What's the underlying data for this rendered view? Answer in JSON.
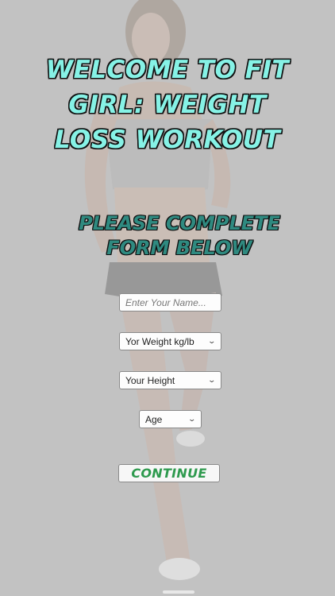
{
  "app": {
    "title": "WELCOME TO FIT GIRL: WEIGHT LOSS WORKOUT",
    "subtitle": "PLEASE COMPLETE FORM BELOW"
  },
  "form": {
    "name_placeholder": "Enter Your Name...",
    "name_value": "",
    "weight_selected": "Yor Weight kg/lb",
    "height_selected": "Your Height",
    "age_selected": "Age",
    "continue_label": "CONTINUE"
  },
  "icons": {
    "dropdown": "chevron-down-icon"
  },
  "colors": {
    "title": "#86f2e6",
    "subtitle": "#2f8a80",
    "continue_text": "#2e9a4e",
    "overlay": "#dadada"
  }
}
